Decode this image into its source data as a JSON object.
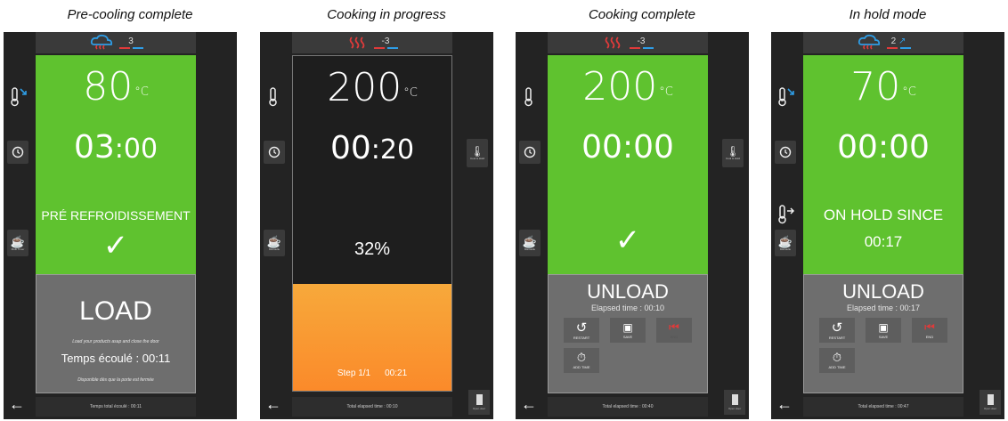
{
  "captions": [
    "Pre-cooling complete",
    "Cooking in progress",
    "Cooking complete",
    "In hold mode"
  ],
  "panels": [
    {
      "step": "3",
      "temp": "80",
      "unit": "°C",
      "time_main": "03",
      "time_sec": ":00",
      "status": "PRÉ REFROIDISSEMENT",
      "check": "✓",
      "side_label": "Multi Timer",
      "bottom_title": "LOAD",
      "bottom_line1": "Load your products asap and close the door",
      "bottom_elapsed": "Temps écoulé : 00:11",
      "bottom_line2": "Disponible dès que la porte est fermée",
      "footer": "Temps total écoulé : 00:11"
    },
    {
      "step": "-3",
      "temp": "200",
      "unit": "°C",
      "time_main": "00",
      "time_sec": ":20",
      "percent": "32%",
      "progress": 0.32,
      "step_label": "Step 1/1",
      "step_time": "00:21",
      "side_label": "Manuelle",
      "right_label": "Cool & Hold",
      "footer": "Total elapsed time : 00:10",
      "door_label": "Open door"
    },
    {
      "step": "-3",
      "temp": "200",
      "unit": "°C",
      "time_main": "00",
      "time_sec": ":00",
      "check": "✓",
      "side_label": "Manuelle",
      "right_label": "Cool & Hold",
      "bottom_title": "UNLOAD",
      "elapsed": "Elapsed time : 00:10",
      "actions": [
        "RESTART",
        "SAVE",
        "END",
        "ADD TIME"
      ],
      "footer": "Total elapsed time : 00:40",
      "door_label": "Open door"
    },
    {
      "step": "2",
      "temp": "70",
      "unit": "°C",
      "time_main": "00",
      "time_sec": ":00",
      "status": "ON HOLD SINCE",
      "hold_time": "00:17",
      "side_label": "Manuelle",
      "bottom_title": "UNLOAD",
      "elapsed": "Elapsed time : 00:17",
      "actions": [
        "RESTART",
        "SAVE",
        "END",
        "ADD TIME"
      ],
      "footer": "Total elapsed time : 00:47",
      "door_label": "Open door"
    }
  ],
  "colors": {
    "green": "#5fc22f",
    "orange": "#f7a93b",
    "red": "#e03a3a",
    "blue": "#2e9de6",
    "dark": "#232323"
  }
}
